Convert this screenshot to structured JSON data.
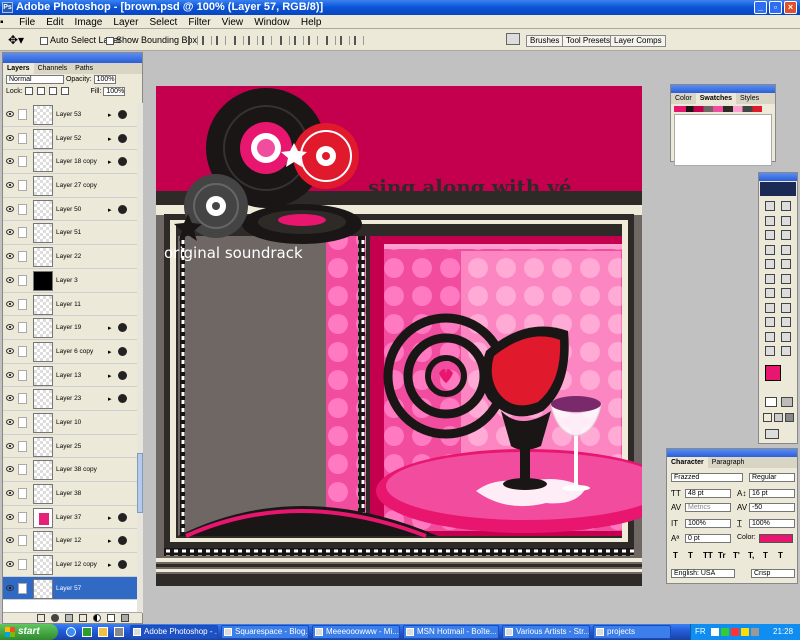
{
  "window": {
    "title": "Adobe Photoshop - [brown.psd @ 100% (Layer 57, RGB/8)]"
  },
  "menu": [
    "File",
    "Edit",
    "Image",
    "Layer",
    "Select",
    "Filter",
    "View",
    "Window",
    "Help"
  ],
  "options": {
    "auto_select": "Auto Select Layer",
    "bounding_box": "Show Bounding Box",
    "well_tabs": [
      "Brushes",
      "Tool Presets",
      "Layer Comps"
    ]
  },
  "layers_panel": {
    "tabs": [
      "Layers",
      "Channels",
      "Paths"
    ],
    "blend_mode": "Normal",
    "opacity_label": "Opacity:",
    "opacity": "100%",
    "lock_label": "Lock:",
    "fill_label": "Fill:",
    "fill": "100%",
    "layers": [
      {
        "name": "Layer 53",
        "fx": true
      },
      {
        "name": "Layer 52",
        "fx": true
      },
      {
        "name": "Layer 18 copy",
        "fx": true
      },
      {
        "name": "Layer 27 copy",
        "fx": false
      },
      {
        "name": "Layer 50",
        "fx": true
      },
      {
        "name": "Layer 51",
        "fx": false
      },
      {
        "name": "Layer 22",
        "fx": false
      },
      {
        "name": "Layer 3",
        "fx": false,
        "thumb": "black"
      },
      {
        "name": "Layer 11",
        "fx": false
      },
      {
        "name": "Layer 19",
        "fx": true
      },
      {
        "name": "Layer 6 copy",
        "fx": true
      },
      {
        "name": "Layer 13",
        "fx": true
      },
      {
        "name": "Layer 23",
        "fx": true
      },
      {
        "name": "Layer 10",
        "fx": false
      },
      {
        "name": "Layer 25",
        "fx": false
      },
      {
        "name": "Layer 38 copy",
        "fx": false
      },
      {
        "name": "Layer 38",
        "fx": false
      },
      {
        "name": "Layer 37",
        "fx": true,
        "thumb": "pink"
      },
      {
        "name": "Layer 12",
        "fx": true
      },
      {
        "name": "Layer 12 copy",
        "fx": true
      },
      {
        "name": "Layer 57",
        "fx": false,
        "selected": true
      }
    ]
  },
  "canvas": {
    "heading": "sing along with vé",
    "subtitle": "original soundrack"
  },
  "swatches_panel": {
    "tabs": [
      "Color",
      "Swatches",
      "Styles"
    ]
  },
  "character_panel": {
    "tabs": [
      "Character",
      "Paragraph"
    ],
    "font_family": "Frazzed",
    "font_style": "Regular",
    "font_size": "48 pt",
    "leading": "16 pt",
    "kerning": "Metrics",
    "tracking": "-50",
    "vertical_scale": "100%",
    "horizontal_scale": "100%",
    "baseline_shift": "0 pt",
    "color_label": "Color:",
    "text_color": "#e8166e",
    "language": "English: USA",
    "antialias": "Crisp",
    "style_buttons": [
      "T",
      "T",
      "TT",
      "Tr",
      "T'",
      "T,",
      "T",
      "T"
    ]
  },
  "taskbar": {
    "start": "start",
    "tasks": [
      "Adobe Photoshop - ...",
      "Squarespace - Blog...",
      "Meeeooowww - Mi...",
      "MSN Hotmail - Boîte...",
      "Various Artists - Str...",
      "projects"
    ],
    "language": "FR",
    "clock": "21:28"
  },
  "colors": {
    "accent_pink": "#e8166e",
    "magenta_header": "#c4004e",
    "dark_panel": "#2e2a28",
    "gray_block": "#6e6764"
  }
}
